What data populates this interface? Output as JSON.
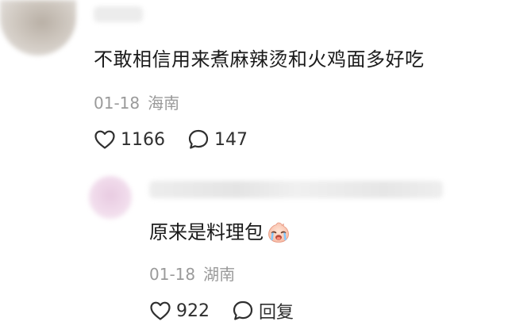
{
  "comment": {
    "text": "不敢相信用来煮麻辣烫和火鸡面多好吃",
    "date": "01-18",
    "location": "海南",
    "like_count": "1166",
    "reply_count": "147",
    "icons": {
      "like": "heart-outline-icon",
      "reply": "speech-bubble-icon"
    }
  },
  "reply": {
    "text": "原来是料理包",
    "emoji": "crying-face-emoji",
    "date": "01-18",
    "location": "湖南",
    "like_count": "922",
    "reply_label": "回复",
    "icons": {
      "like": "heart-outline-icon",
      "reply": "speech-bubble-icon"
    }
  }
}
